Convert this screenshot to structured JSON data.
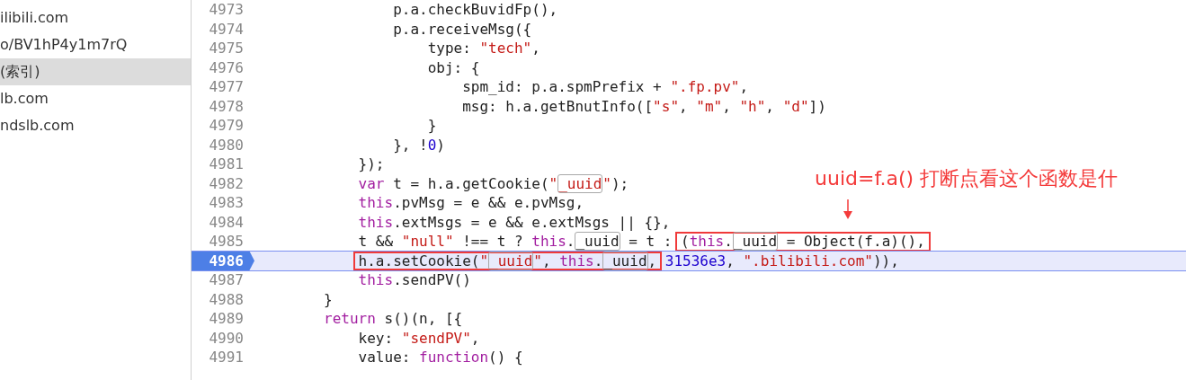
{
  "sidebar": {
    "items": [
      {
        "label": "ilibili.com",
        "selected": false
      },
      {
        "label": "o/BV1hP4y1m7rQ",
        "selected": false
      },
      {
        "label": "(索引)",
        "selected": true
      },
      {
        "label": "lb.com",
        "selected": false
      },
      {
        "label": "ndslb.com",
        "selected": false
      }
    ]
  },
  "code": {
    "lines": [
      {
        "number": "4973",
        "current": false,
        "segments": [
          {
            "outlined": false,
            "tokens": [
              {
                "kind": "plain",
                "text": "                p.a.checkBuvidFp(),"
              }
            ]
          }
        ]
      },
      {
        "number": "4974",
        "current": false,
        "segments": [
          {
            "outlined": false,
            "tokens": [
              {
                "kind": "plain",
                "text": "                p.a.receiveMsg({"
              }
            ]
          }
        ]
      },
      {
        "number": "4975",
        "current": false,
        "segments": [
          {
            "outlined": false,
            "tokens": [
              {
                "kind": "plain",
                "text": "                    type: "
              },
              {
                "kind": "string",
                "text": "\"tech\""
              },
              {
                "kind": "plain",
                "text": ","
              }
            ]
          }
        ]
      },
      {
        "number": "4976",
        "current": false,
        "segments": [
          {
            "outlined": false,
            "tokens": [
              {
                "kind": "plain",
                "text": "                    obj: {"
              }
            ]
          }
        ]
      },
      {
        "number": "4977",
        "current": false,
        "segments": [
          {
            "outlined": false,
            "tokens": [
              {
                "kind": "plain",
                "text": "                        spm_id: p.a.spmPrefix + "
              },
              {
                "kind": "string",
                "text": "\".fp.pv\""
              },
              {
                "kind": "plain",
                "text": ","
              }
            ]
          }
        ]
      },
      {
        "number": "4978",
        "current": false,
        "segments": [
          {
            "outlined": false,
            "tokens": [
              {
                "kind": "plain",
                "text": "                        msg: h.a.getBnutInfo(["
              },
              {
                "kind": "string",
                "text": "\"s\""
              },
              {
                "kind": "plain",
                "text": ", "
              },
              {
                "kind": "string",
                "text": "\"m\""
              },
              {
                "kind": "plain",
                "text": ", "
              },
              {
                "kind": "string",
                "text": "\"h\""
              },
              {
                "kind": "plain",
                "text": ", "
              },
              {
                "kind": "string",
                "text": "\"d\""
              },
              {
                "kind": "plain",
                "text": "])"
              }
            ]
          }
        ]
      },
      {
        "number": "4979",
        "current": false,
        "segments": [
          {
            "outlined": false,
            "tokens": [
              {
                "kind": "plain",
                "text": "                    }"
              }
            ]
          }
        ]
      },
      {
        "number": "4980",
        "current": false,
        "segments": [
          {
            "outlined": false,
            "tokens": [
              {
                "kind": "plain",
                "text": "                }, !"
              },
              {
                "kind": "number",
                "text": "0"
              },
              {
                "kind": "plain",
                "text": ")"
              }
            ]
          }
        ]
      },
      {
        "number": "4981",
        "current": false,
        "segments": [
          {
            "outlined": false,
            "tokens": [
              {
                "kind": "plain",
                "text": "            });"
              }
            ]
          }
        ]
      },
      {
        "number": "4982",
        "current": false,
        "segments": [
          {
            "outlined": false,
            "tokens": [
              {
                "kind": "keyword",
                "text": "            var"
              },
              {
                "kind": "plain",
                "text": " t = h.a.getCookie("
              },
              {
                "kind": "string",
                "text": "\""
              },
              {
                "kind": "string-match",
                "text": "_uuid"
              },
              {
                "kind": "string",
                "text": "\""
              },
              {
                "kind": "plain",
                "text": ");"
              }
            ]
          }
        ]
      },
      {
        "number": "4983",
        "current": false,
        "segments": [
          {
            "outlined": false,
            "tokens": [
              {
                "kind": "keyword",
                "text": "            this"
              },
              {
                "kind": "plain",
                "text": ".pvMsg = e && e.pvMsg,"
              }
            ]
          }
        ]
      },
      {
        "number": "4984",
        "current": false,
        "segments": [
          {
            "outlined": false,
            "tokens": [
              {
                "kind": "keyword",
                "text": "            this"
              },
              {
                "kind": "plain",
                "text": ".extMsgs = e && e.extMsgs || {},"
              }
            ]
          }
        ]
      },
      {
        "number": "4985",
        "current": false,
        "segments": [
          {
            "outlined": false,
            "tokens": [
              {
                "kind": "plain",
                "text": "            t && "
              },
              {
                "kind": "string",
                "text": "\"null\""
              },
              {
                "kind": "plain",
                "text": " !== t ? "
              },
              {
                "kind": "keyword",
                "text": "this"
              },
              {
                "kind": "plain",
                "text": "."
              },
              {
                "kind": "match",
                "text": "_uuid"
              },
              {
                "kind": "plain",
                "text": " = t : "
              }
            ]
          },
          {
            "outlined": true,
            "tokens": [
              {
                "kind": "plain",
                "text": "("
              },
              {
                "kind": "keyword",
                "text": "this"
              },
              {
                "kind": "plain",
                "text": "."
              },
              {
                "kind": "match",
                "text": "_uuid"
              },
              {
                "kind": "plain",
                "text": " = Object(f.a)(),"
              }
            ]
          }
        ]
      },
      {
        "number": "4986",
        "current": true,
        "segments": [
          {
            "outlined": true,
            "tokens": [
              {
                "kind": "plain",
                "text": "            h.a.setCookie("
              },
              {
                "kind": "string",
                "text": "\""
              },
              {
                "kind": "string-match",
                "text": "_uuid"
              },
              {
                "kind": "string",
                "text": "\""
              },
              {
                "kind": "plain",
                "text": ", "
              },
              {
                "kind": "keyword",
                "text": "this"
              },
              {
                "kind": "plain",
                "text": "."
              },
              {
                "kind": "match",
                "text": "_uuid"
              },
              {
                "kind": "plain",
                "text": ","
              }
            ]
          },
          {
            "outlined": false,
            "tokens": [
              {
                "kind": "number",
                "text": " 31536e3"
              },
              {
                "kind": "plain",
                "text": ", "
              },
              {
                "kind": "string",
                "text": "\".bilibili.com\""
              },
              {
                "kind": "plain",
                "text": ")),"
              }
            ]
          }
        ]
      },
      {
        "number": "4987",
        "current": false,
        "segments": [
          {
            "outlined": false,
            "tokens": [
              {
                "kind": "keyword",
                "text": "            this"
              },
              {
                "kind": "plain",
                "text": ".sendPV()"
              }
            ]
          }
        ]
      },
      {
        "number": "4988",
        "current": false,
        "segments": [
          {
            "outlined": false,
            "tokens": [
              {
                "kind": "plain",
                "text": "        }"
              }
            ]
          }
        ]
      },
      {
        "number": "4989",
        "current": false,
        "segments": [
          {
            "outlined": false,
            "tokens": [
              {
                "kind": "keyword",
                "text": "        return"
              },
              {
                "kind": "plain",
                "text": " s()(n, [{"
              }
            ]
          }
        ]
      },
      {
        "number": "4990",
        "current": false,
        "segments": [
          {
            "outlined": false,
            "tokens": [
              {
                "kind": "plain",
                "text": "            key: "
              },
              {
                "kind": "string",
                "text": "\"sendPV\""
              },
              {
                "kind": "plain",
                "text": ","
              }
            ]
          }
        ]
      },
      {
        "number": "4991",
        "current": false,
        "segments": [
          {
            "outlined": false,
            "tokens": [
              {
                "kind": "plain",
                "text": "            value: "
              },
              {
                "kind": "keyword",
                "text": "function"
              },
              {
                "kind": "plain",
                "text": "() {"
              }
            ]
          }
        ]
      }
    ]
  },
  "annotation": {
    "text": "uuid=f.a() 打断点看这个函数是什"
  }
}
